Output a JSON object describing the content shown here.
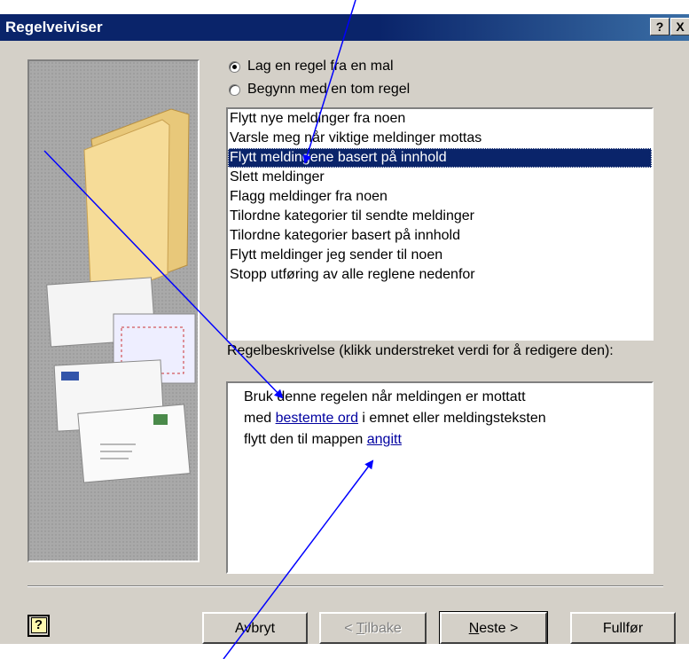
{
  "window": {
    "title": "Regelveiviser",
    "help_glyph": "?",
    "close_glyph": "X"
  },
  "options": [
    {
      "label": "Lag en regel fra en mal",
      "checked": true
    },
    {
      "label": "Begynn med en tom regel",
      "checked": false
    }
  ],
  "templates": [
    {
      "label": "Flytt nye meldinger fra noen",
      "selected": false
    },
    {
      "label": "Varsle meg når viktige meldinger mottas",
      "selected": false
    },
    {
      "label": "Flytt meldingene basert på innhold",
      "selected": true
    },
    {
      "label": "Slett meldinger",
      "selected": false
    },
    {
      "label": "Flagg meldinger fra noen",
      "selected": false
    },
    {
      "label": "Tilordne kategorier til sendte meldinger",
      "selected": false
    },
    {
      "label": "Tilordne kategorier basert på innhold",
      "selected": false
    },
    {
      "label": "Flytt meldinger jeg sender til noen",
      "selected": false
    },
    {
      "label": "Stopp utføring av alle reglene nedenfor",
      "selected": false
    }
  ],
  "description": {
    "label": "Regelbeskrivelse (klikk understreket verdi for å redigere den):",
    "line1": "Bruk denne regelen når meldingen er mottatt",
    "line2_prefix": "med ",
    "line2_link": "bestemte ord",
    "line2_suffix": " i emnet eller meldingsteksten",
    "line3_prefix": "flytt den til mappen ",
    "line3_link": "angitt"
  },
  "buttons": {
    "help": "?",
    "cancel": "Avbryt",
    "back_prefix": "< ",
    "back_access": "T",
    "back_rest": "ilbake",
    "next_access": "N",
    "next_rest": "este >",
    "finish": "Fullfør"
  },
  "colors": {
    "selection": "#0a246a",
    "dialog": "#d4d0c8",
    "annotation_arrows": "#0000ff"
  }
}
